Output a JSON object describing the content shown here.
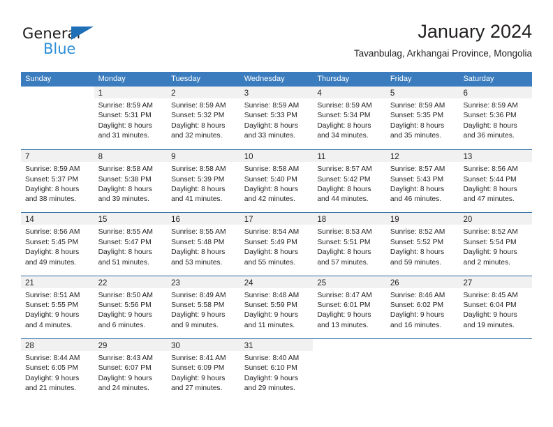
{
  "brand": {
    "name_part1": "General",
    "name_part2": "Blue",
    "triangle_color": "#1f6fb7",
    "blue_color": "#2e8fd8"
  },
  "header": {
    "title": "January 2024",
    "subtitle": "Tavanbulag, Arkhangai Province, Mongolia"
  },
  "theme": {
    "header_bg": "#3a7cbe",
    "header_text": "#ffffff",
    "row_divider": "#2e6da4",
    "daynum_band": "#f1f1f1",
    "text": "#231f20"
  },
  "weekdays": [
    "Sunday",
    "Monday",
    "Tuesday",
    "Wednesday",
    "Thursday",
    "Friday",
    "Saturday"
  ],
  "weeks": [
    [
      {
        "day": "",
        "lines": [
          "",
          "",
          "",
          ""
        ]
      },
      {
        "day": "1",
        "lines": [
          "Sunrise: 8:59 AM",
          "Sunset: 5:31 PM",
          "Daylight: 8 hours",
          "and 31 minutes."
        ]
      },
      {
        "day": "2",
        "lines": [
          "Sunrise: 8:59 AM",
          "Sunset: 5:32 PM",
          "Daylight: 8 hours",
          "and 32 minutes."
        ]
      },
      {
        "day": "3",
        "lines": [
          "Sunrise: 8:59 AM",
          "Sunset: 5:33 PM",
          "Daylight: 8 hours",
          "and 33 minutes."
        ]
      },
      {
        "day": "4",
        "lines": [
          "Sunrise: 8:59 AM",
          "Sunset: 5:34 PM",
          "Daylight: 8 hours",
          "and 34 minutes."
        ]
      },
      {
        "day": "5",
        "lines": [
          "Sunrise: 8:59 AM",
          "Sunset: 5:35 PM",
          "Daylight: 8 hours",
          "and 35 minutes."
        ]
      },
      {
        "day": "6",
        "lines": [
          "Sunrise: 8:59 AM",
          "Sunset: 5:36 PM",
          "Daylight: 8 hours",
          "and 36 minutes."
        ]
      }
    ],
    [
      {
        "day": "7",
        "lines": [
          "Sunrise: 8:59 AM",
          "Sunset: 5:37 PM",
          "Daylight: 8 hours",
          "and 38 minutes."
        ]
      },
      {
        "day": "8",
        "lines": [
          "Sunrise: 8:58 AM",
          "Sunset: 5:38 PM",
          "Daylight: 8 hours",
          "and 39 minutes."
        ]
      },
      {
        "day": "9",
        "lines": [
          "Sunrise: 8:58 AM",
          "Sunset: 5:39 PM",
          "Daylight: 8 hours",
          "and 41 minutes."
        ]
      },
      {
        "day": "10",
        "lines": [
          "Sunrise: 8:58 AM",
          "Sunset: 5:40 PM",
          "Daylight: 8 hours",
          "and 42 minutes."
        ]
      },
      {
        "day": "11",
        "lines": [
          "Sunrise: 8:57 AM",
          "Sunset: 5:42 PM",
          "Daylight: 8 hours",
          "and 44 minutes."
        ]
      },
      {
        "day": "12",
        "lines": [
          "Sunrise: 8:57 AM",
          "Sunset: 5:43 PM",
          "Daylight: 8 hours",
          "and 46 minutes."
        ]
      },
      {
        "day": "13",
        "lines": [
          "Sunrise: 8:56 AM",
          "Sunset: 5:44 PM",
          "Daylight: 8 hours",
          "and 47 minutes."
        ]
      }
    ],
    [
      {
        "day": "14",
        "lines": [
          "Sunrise: 8:56 AM",
          "Sunset: 5:45 PM",
          "Daylight: 8 hours",
          "and 49 minutes."
        ]
      },
      {
        "day": "15",
        "lines": [
          "Sunrise: 8:55 AM",
          "Sunset: 5:47 PM",
          "Daylight: 8 hours",
          "and 51 minutes."
        ]
      },
      {
        "day": "16",
        "lines": [
          "Sunrise: 8:55 AM",
          "Sunset: 5:48 PM",
          "Daylight: 8 hours",
          "and 53 minutes."
        ]
      },
      {
        "day": "17",
        "lines": [
          "Sunrise: 8:54 AM",
          "Sunset: 5:49 PM",
          "Daylight: 8 hours",
          "and 55 minutes."
        ]
      },
      {
        "day": "18",
        "lines": [
          "Sunrise: 8:53 AM",
          "Sunset: 5:51 PM",
          "Daylight: 8 hours",
          "and 57 minutes."
        ]
      },
      {
        "day": "19",
        "lines": [
          "Sunrise: 8:52 AM",
          "Sunset: 5:52 PM",
          "Daylight: 8 hours",
          "and 59 minutes."
        ]
      },
      {
        "day": "20",
        "lines": [
          "Sunrise: 8:52 AM",
          "Sunset: 5:54 PM",
          "Daylight: 9 hours",
          "and 2 minutes."
        ]
      }
    ],
    [
      {
        "day": "21",
        "lines": [
          "Sunrise: 8:51 AM",
          "Sunset: 5:55 PM",
          "Daylight: 9 hours",
          "and 4 minutes."
        ]
      },
      {
        "day": "22",
        "lines": [
          "Sunrise: 8:50 AM",
          "Sunset: 5:56 PM",
          "Daylight: 9 hours",
          "and 6 minutes."
        ]
      },
      {
        "day": "23",
        "lines": [
          "Sunrise: 8:49 AM",
          "Sunset: 5:58 PM",
          "Daylight: 9 hours",
          "and 9 minutes."
        ]
      },
      {
        "day": "24",
        "lines": [
          "Sunrise: 8:48 AM",
          "Sunset: 5:59 PM",
          "Daylight: 9 hours",
          "and 11 minutes."
        ]
      },
      {
        "day": "25",
        "lines": [
          "Sunrise: 8:47 AM",
          "Sunset: 6:01 PM",
          "Daylight: 9 hours",
          "and 13 minutes."
        ]
      },
      {
        "day": "26",
        "lines": [
          "Sunrise: 8:46 AM",
          "Sunset: 6:02 PM",
          "Daylight: 9 hours",
          "and 16 minutes."
        ]
      },
      {
        "day": "27",
        "lines": [
          "Sunrise: 8:45 AM",
          "Sunset: 6:04 PM",
          "Daylight: 9 hours",
          "and 19 minutes."
        ]
      }
    ],
    [
      {
        "day": "28",
        "lines": [
          "Sunrise: 8:44 AM",
          "Sunset: 6:05 PM",
          "Daylight: 9 hours",
          "and 21 minutes."
        ]
      },
      {
        "day": "29",
        "lines": [
          "Sunrise: 8:43 AM",
          "Sunset: 6:07 PM",
          "Daylight: 9 hours",
          "and 24 minutes."
        ]
      },
      {
        "day": "30",
        "lines": [
          "Sunrise: 8:41 AM",
          "Sunset: 6:09 PM",
          "Daylight: 9 hours",
          "and 27 minutes."
        ]
      },
      {
        "day": "31",
        "lines": [
          "Sunrise: 8:40 AM",
          "Sunset: 6:10 PM",
          "Daylight: 9 hours",
          "and 29 minutes."
        ]
      },
      {
        "day": "",
        "lines": [
          "",
          "",
          "",
          ""
        ]
      },
      {
        "day": "",
        "lines": [
          "",
          "",
          "",
          ""
        ]
      },
      {
        "day": "",
        "lines": [
          "",
          "",
          "",
          ""
        ]
      }
    ]
  ]
}
